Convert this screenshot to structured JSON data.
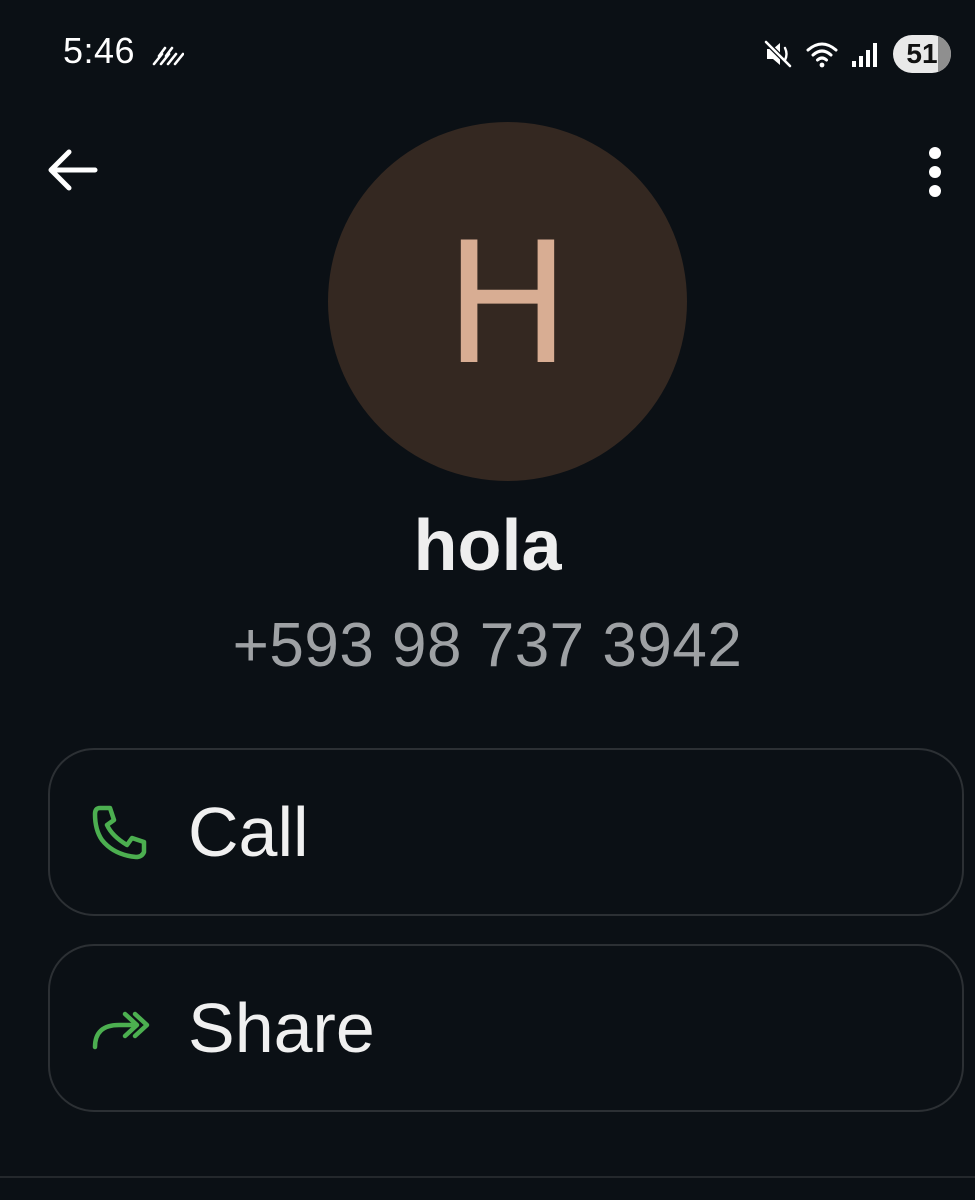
{
  "status_bar": {
    "time": "5:46",
    "battery": "51",
    "battery_level_percent": 51,
    "icons": [
      "mute-vibrate-icon",
      "wifi-icon",
      "signal-icon",
      "battery-icon"
    ]
  },
  "toolbar": {
    "back_icon": "arrow-left-icon",
    "menu_icon": "more-vertical-icon"
  },
  "contact": {
    "avatar_letter": "H",
    "name": "hola",
    "phone": "+593 98 737 3942"
  },
  "actions": [
    {
      "label": "Call",
      "icon": "phone-icon"
    },
    {
      "label": "Share",
      "icon": "share-arrow-icon"
    }
  ],
  "colors": {
    "background": "#0b1015",
    "avatar_bg": "#342821",
    "avatar_letter": "#d8ad93",
    "accent_green": "#4caf50",
    "secondary_text": "#9ea1a4"
  }
}
